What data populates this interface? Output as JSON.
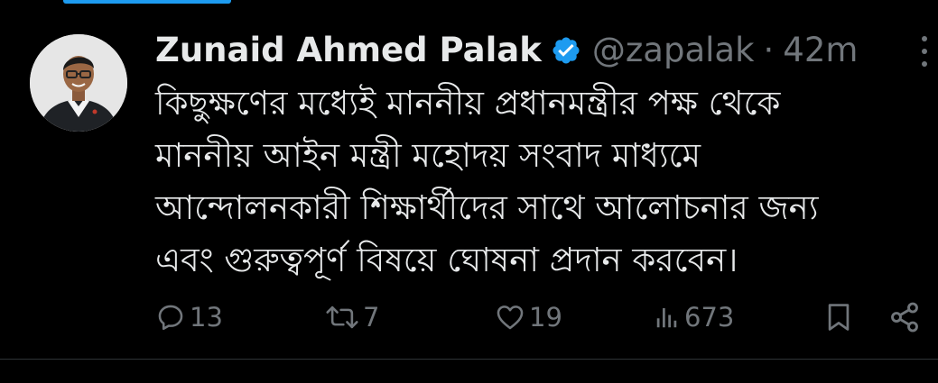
{
  "tweet": {
    "author": {
      "name": "Zunaid Ahmed Palak",
      "handle": "@zapalak",
      "separator": "·",
      "time": "42m",
      "verified": true
    },
    "text_lines": [
      "কিছুক্ষণের মধ্যেই মাননীয় প্রধানমন্ত্রীর পক্ষ থেকে",
      "মাননীয় আইন মন্ত্রী মহোদয় সংবাদ মাধ্যমে",
      "আন্দোলনকারী শিক্ষার্থীদের সাথে আলোচনার জন্য",
      "এবং গুরুত্বপূর্ণ বিষয়ে ঘোষনা প্রদান করবেন।"
    ],
    "actions": {
      "replies": "13",
      "reposts": "7",
      "likes": "19",
      "views": "673"
    }
  },
  "icons": {
    "verified": "verified-badge-icon",
    "more": "more-options-icon",
    "reply": "reply-icon",
    "repost": "repost-icon",
    "like": "heart-icon",
    "views": "views-icon",
    "bookmark": "bookmark-icon",
    "share": "share-icon"
  },
  "colors": {
    "background": "#000000",
    "text": "#e7e9ea",
    "muted": "#71767b",
    "accent": "#1d9bf0"
  }
}
